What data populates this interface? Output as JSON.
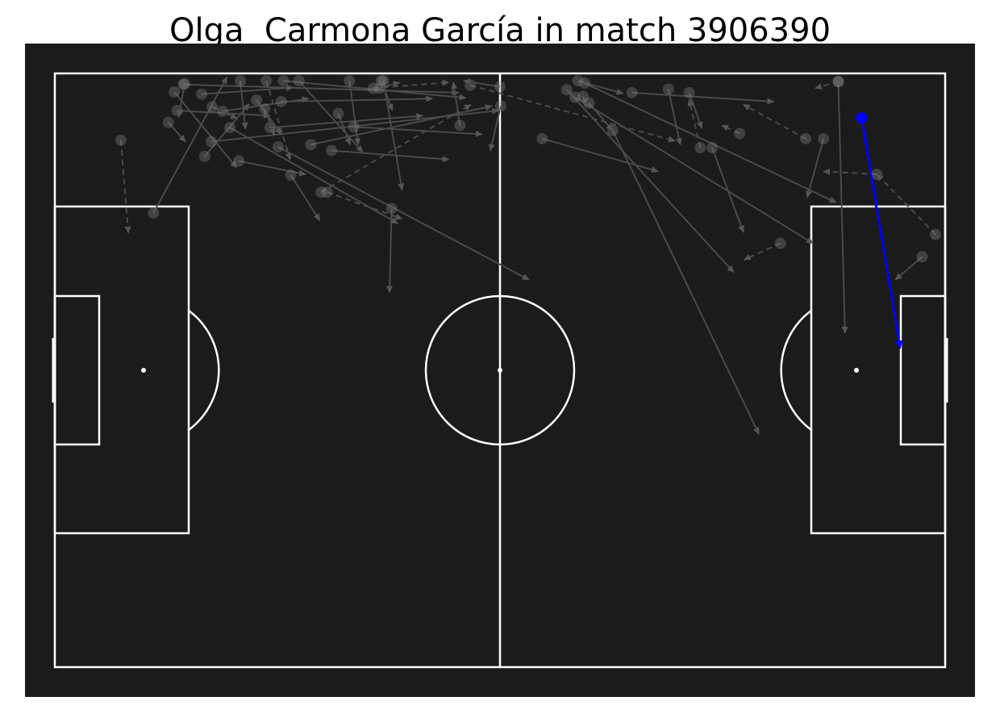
{
  "title": "Olga  Carmona García in match 3906390",
  "colors": {
    "background": "#ffffff",
    "pitch": "#1b1b1b",
    "lines": "#ffffff",
    "events": "#8a8a8a",
    "highlight": "#0000ff"
  },
  "pitch": {
    "length": 120,
    "width": 80
  },
  "chart_data": {
    "type": "scatter",
    "pitch_units": {
      "x": [
        0,
        120
      ],
      "y": [
        0,
        80
      ]
    },
    "events": [
      {
        "x": 8.9,
        "y": 9.0,
        "end_x": 9.9,
        "end_y": 21.5,
        "style": "dashed"
      },
      {
        "x": 13.3,
        "y": 18.8,
        "end_x": 23.2,
        "end_y": 0.5,
        "style": "solid"
      },
      {
        "x": 16.1,
        "y": 2.5,
        "end_x": 24.5,
        "end_y": 12.7,
        "style": "solid"
      },
      {
        "x": 17.3,
        "y": 1.5,
        "end_x": 54.4,
        "end_y": 2.6,
        "style": "solid"
      },
      {
        "x": 19.8,
        "y": 2.8,
        "end_x": 32.1,
        "end_y": 1.9,
        "style": "solid"
      },
      {
        "x": 16.5,
        "y": 5.0,
        "end_x": 29.0,
        "end_y": 5.7,
        "style": "solid"
      },
      {
        "x": 20.2,
        "y": 11.2,
        "end_x": 26.2,
        "end_y": 4.1,
        "style": "solid"
      },
      {
        "x": 24.8,
        "y": 11.8,
        "end_x": 33.8,
        "end_y": 13.6,
        "style": "solid"
      },
      {
        "x": 25.0,
        "y": 1.0,
        "end_x": 25.7,
        "end_y": 7.5,
        "style": "solid"
      },
      {
        "x": 22.6,
        "y": 5.1,
        "end_x": 34.2,
        "end_y": 3.4,
        "style": "solid"
      },
      {
        "x": 21.1,
        "y": 9.2,
        "end_x": 59.8,
        "end_y": 5.0,
        "style": "solid"
      },
      {
        "x": 28.5,
        "y": 1.0,
        "end_x": 31.7,
        "end_y": 11.6,
        "style": "dashed"
      },
      {
        "x": 30.8,
        "y": 1.0,
        "end_x": 55.4,
        "end_y": 3.3,
        "style": "solid"
      },
      {
        "x": 30.1,
        "y": 9.9,
        "end_x": 63.9,
        "end_y": 27.8,
        "style": "solid"
      },
      {
        "x": 32.9,
        "y": 1.0,
        "end_x": 41.5,
        "end_y": 10.6,
        "style": "solid"
      },
      {
        "x": 30.5,
        "y": 3.8,
        "end_x": 50.9,
        "end_y": 3.4,
        "style": "solid"
      },
      {
        "x": 29.0,
        "y": 7.3,
        "end_x": 49.6,
        "end_y": 5.7,
        "style": "solid"
      },
      {
        "x": 31.8,
        "y": 13.7,
        "end_x": 35.7,
        "end_y": 19.8,
        "style": "solid"
      },
      {
        "x": 34.5,
        "y": 9.6,
        "end_x": 58.9,
        "end_y": 4.4,
        "style": "solid"
      },
      {
        "x": 39.7,
        "y": 1.0,
        "end_x": 40.9,
        "end_y": 9.6,
        "style": "solid"
      },
      {
        "x": 37.3,
        "y": 10.4,
        "end_x": 53.1,
        "end_y": 11.6,
        "style": "solid"
      },
      {
        "x": 40.3,
        "y": 7.2,
        "end_x": 57.6,
        "end_y": 8.2,
        "style": "solid"
      },
      {
        "x": 44.3,
        "y": 1.0,
        "end_x": 46.8,
        "end_y": 15.7,
        "style": "solid"
      },
      {
        "x": 45.4,
        "y": 18.2,
        "end_x": 45.1,
        "end_y": 29.5,
        "style": "solid"
      },
      {
        "x": 35.9,
        "y": 16.0,
        "end_x": 56.1,
        "end_y": 4.2,
        "style": "dashed"
      },
      {
        "x": 36.7,
        "y": 16.0,
        "end_x": 46.8,
        "end_y": 19.6,
        "style": "dashed"
      },
      {
        "x": 23.6,
        "y": 7.3,
        "end_x": 46.2,
        "end_y": 20.2,
        "style": "solid"
      },
      {
        "x": 42.9,
        "y": 2.0,
        "end_x": 53.1,
        "end_y": 1.2,
        "style": "dashed"
      },
      {
        "x": 60.1,
        "y": 4.4,
        "end_x": 58.7,
        "end_y": 10.4,
        "style": "solid"
      },
      {
        "x": 56.0,
        "y": 1.6,
        "end_x": 83.6,
        "end_y": 9.1,
        "style": "dashed"
      },
      {
        "x": 65.7,
        "y": 8.8,
        "end_x": 81.3,
        "end_y": 13.2,
        "style": "solid"
      },
      {
        "x": 69.0,
        "y": 2.2,
        "end_x": 91.5,
        "end_y": 26.8,
        "style": "solid"
      },
      {
        "x": 70.1,
        "y": 3.2,
        "end_x": 102.2,
        "end_y": 22.9,
        "style": "solid"
      },
      {
        "x": 70.5,
        "y": 1.0,
        "end_x": 76.6,
        "end_y": 2.7,
        "style": "solid"
      },
      {
        "x": 71.4,
        "y": 1.3,
        "end_x": 105.3,
        "end_y": 17.4,
        "style": "solid"
      },
      {
        "x": 75.2,
        "y": 7.7,
        "end_x": 94.9,
        "end_y": 48.6,
        "style": "solid"
      },
      {
        "x": 77.8,
        "y": 2.6,
        "end_x": 96.9,
        "end_y": 3.8,
        "style": "solid"
      },
      {
        "x": 82.7,
        "y": 2.1,
        "end_x": 84.3,
        "end_y": 9.6,
        "style": "solid"
      },
      {
        "x": 85.5,
        "y": 2.6,
        "end_x": 87.2,
        "end_y": 7.4,
        "style": "solid"
      },
      {
        "x": 88.6,
        "y": 10.0,
        "end_x": 92.8,
        "end_y": 21.4,
        "style": "solid"
      },
      {
        "x": 97.8,
        "y": 22.9,
        "end_x": 92.9,
        "end_y": 25.1,
        "style": "dashed"
      },
      {
        "x": 105.6,
        "y": 1.1,
        "end_x": 106.5,
        "end_y": 35.0,
        "style": "solid"
      },
      {
        "x": 103.6,
        "y": 8.8,
        "end_x": 101.4,
        "end_y": 16.7,
        "style": "solid"
      },
      {
        "x": 110.8,
        "y": 13.6,
        "end_x": 103.6,
        "end_y": 13.2,
        "style": "dashed"
      },
      {
        "x": 116.9,
        "y": 24.7,
        "end_x": 113.3,
        "end_y": 27.8,
        "style": "solid"
      },
      {
        "x": 118.7,
        "y": 21.7,
        "end_x": 110.8,
        "end_y": 13.6,
        "style": "dashed"
      },
      {
        "x": 105.6,
        "y": 1.1,
        "end_x": 102.5,
        "end_y": 2.0,
        "style": "dashed"
      },
      {
        "x": 92.3,
        "y": 8.1,
        "end_x": 89.9,
        "end_y": 7.0,
        "style": "dashed"
      },
      {
        "x": 101.2,
        "y": 8.8,
        "end_x": 92.8,
        "end_y": 4.2,
        "style": "dashed"
      },
      {
        "x": 43.8,
        "y": 2.0,
        "end_x": 46.5,
        "end_y": 1.2,
        "style": "solid"
      },
      {
        "x": 60.0,
        "y": 1.8,
        "end_x": 55.1,
        "end_y": 1.0,
        "style": "solid"
      },
      {
        "x": 87.0,
        "y": 10.0,
        "end_x": 85.5,
        "end_y": 3.5,
        "style": "dashed"
      },
      {
        "x": 15.3,
        "y": 6.6,
        "end_x": 17.6,
        "end_y": 9.2,
        "style": "solid"
      },
      {
        "x": 44.0,
        "y": 1.0,
        "end_x": 45.5,
        "end_y": 5.0,
        "style": "solid"
      },
      {
        "x": 27.2,
        "y": 3.6,
        "end_x": 30.5,
        "end_y": 8.2,
        "style": "solid"
      },
      {
        "x": 54.6,
        "y": 7.0,
        "end_x": 53.7,
        "end_y": 1.2,
        "style": "solid"
      },
      {
        "x": 72.0,
        "y": 4.0,
        "end_x": 75.2,
        "end_y": 7.7,
        "style": "solid"
      },
      {
        "x": 17.5,
        "y": 1.4,
        "end_x": 16.7,
        "end_y": 5.9,
        "style": "solid"
      },
      {
        "x": 71.2,
        "y": 3.1,
        "end_x": 71.6,
        "end_y": 4.5,
        "style": "solid"
      },
      {
        "x": 28.3,
        "y": 4.8,
        "end_x": 29.6,
        "end_y": 8.3,
        "style": "solid"
      },
      {
        "x": 21.2,
        "y": 4.5,
        "end_x": 24.6,
        "end_y": 6.1,
        "style": "solid"
      },
      {
        "x": 38.2,
        "y": 5.4,
        "end_x": 39.8,
        "end_y": 9.6,
        "style": "solid"
      }
    ],
    "highlight": {
      "x": 108.7,
      "y": 6.0,
      "end_x": 113.9,
      "end_y": 37.0
    }
  }
}
